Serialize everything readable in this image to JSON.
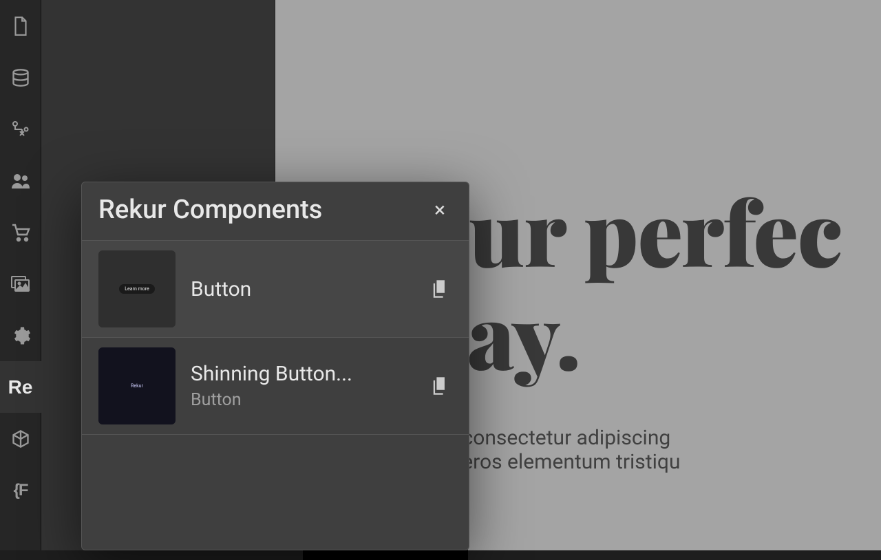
{
  "sidebar": {
    "items": [
      {
        "id": "page-icon"
      },
      {
        "id": "database-icon"
      },
      {
        "id": "sitemap-icon"
      },
      {
        "id": "users-icon"
      },
      {
        "id": "cart-icon"
      },
      {
        "id": "image-icon"
      },
      {
        "id": "gear-icon"
      },
      {
        "id": "rekur-icon",
        "label": "Re"
      },
      {
        "id": "cube-icon"
      },
      {
        "id": "font-icon",
        "label": "{F"
      }
    ],
    "active_index": 7
  },
  "popover": {
    "title": "Rekur Components",
    "components": [
      {
        "name": "Button",
        "subtitle": "",
        "thumb_text": "Learn more"
      },
      {
        "name": "Shinning Button...",
        "subtitle": "Button",
        "thumb_text": "Rekur"
      }
    ]
  },
  "canvas": {
    "headline_line1": "d your perfec",
    "headline_line2": "rt stay.",
    "body_line1": "m dolor sit amet, consectetur adipiscing",
    "body_line2": "se varius enim in eros elementum tristiqu"
  }
}
